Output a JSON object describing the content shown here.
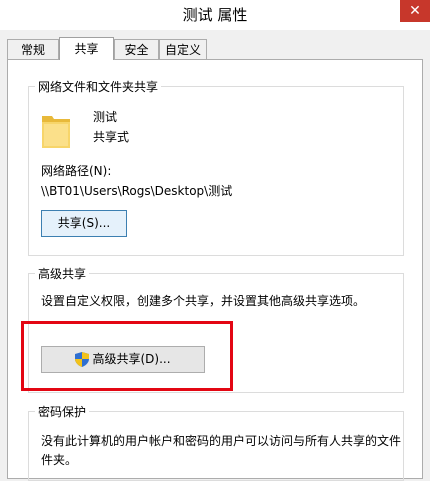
{
  "window": {
    "title": "测试 属性",
    "close_glyph": "✕"
  },
  "tabs": [
    {
      "label": "常规"
    },
    {
      "label": "共享",
      "active": true
    },
    {
      "label": "安全"
    },
    {
      "label": "自定义"
    }
  ],
  "network_sharing": {
    "group_title": "网络文件和文件夹共享",
    "folder_icon": "folder-icon",
    "folder_name": "测试",
    "share_status": "共享式",
    "network_path_label": "网络路径(N):",
    "network_path": "\\\\BT01\\Users\\Rogs\\Desktop\\测试",
    "share_button": "共享(S)..."
  },
  "advanced_sharing": {
    "group_title": "高级共享",
    "description": "设置自定义权限，创建多个共享，并设置其他高级共享选项。",
    "button_icon": "uac-shield-icon",
    "button_label": "高级共享(D)..."
  },
  "password_protection": {
    "group_title": "密码保护",
    "description_line1": "没有此计算机的用户帐户和密码的用户可以访问与所有人共享的文件",
    "description_line2": "件夹。"
  },
  "colors": {
    "highlight_box": "#e30613",
    "close_button": "#c7372b",
    "folder": "#f2c94c"
  }
}
